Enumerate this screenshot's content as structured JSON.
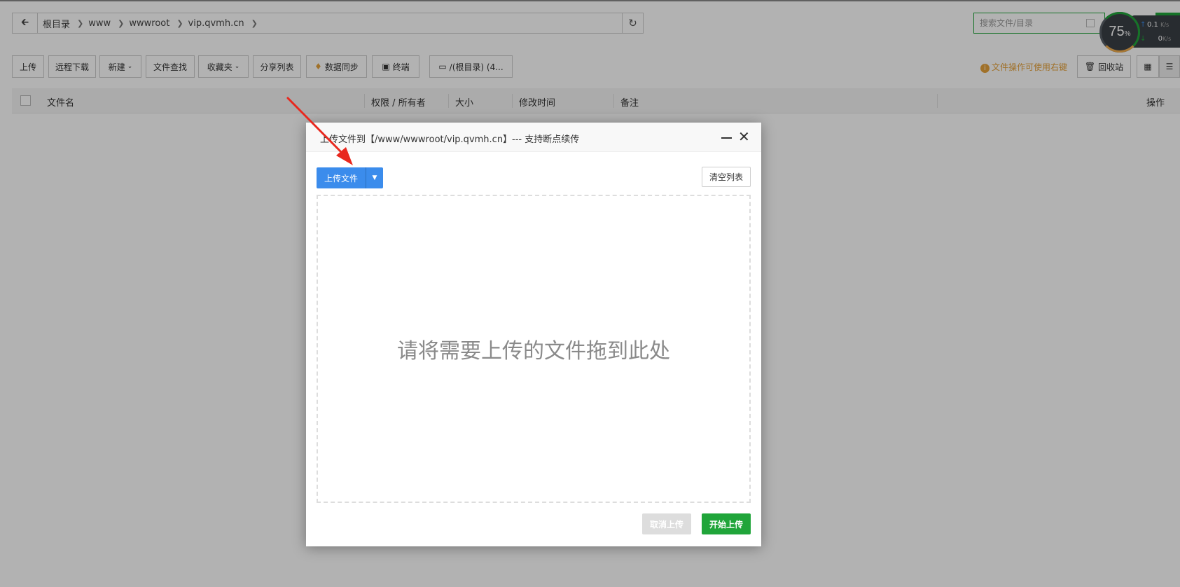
{
  "breadcrumb": {
    "back_icon": "arrow-left-icon",
    "items": [
      "根目录",
      "www",
      "wwwroot",
      "vip.qvmh.cn"
    ],
    "refresh_icon": "refresh-icon"
  },
  "search": {
    "placeholder": "搜索文件/目录"
  },
  "monitor": {
    "percent": "75",
    "percent_unit": "%",
    "up_value": "0.1",
    "down_value": "0",
    "unit": "K/s"
  },
  "toolbar": {
    "upload": "上传",
    "remote_download": "远程下载",
    "new": "新建",
    "file_search": "文件查找",
    "favorites": "收藏夹",
    "share_list": "分享列表",
    "data_sync": "数据同步",
    "terminal": "终端",
    "disk": "/(根目录) (4...",
    "tip": "文件操作可使用右键",
    "recycle": "回收站"
  },
  "table": {
    "headers": {
      "name": "文件名",
      "perm": "权限 / 所有者",
      "size": "大小",
      "mtime": "修改时间",
      "note": "备注",
      "ops": "操作"
    }
  },
  "modal": {
    "title": "上传文件到【/www/wwwroot/vip.qvmh.cn】--- 支持断点续传",
    "upload_btn": "上传文件",
    "clear_btn": "清空列表",
    "drop_text": "请将需要上传的文件拖到此处",
    "cancel_btn": "取消上传",
    "start_btn": "开始上传"
  },
  "colors": {
    "accent_green": "#20a53a",
    "upload_blue": "#3b8cec",
    "tip_orange": "#e6a23c",
    "annotation_red": "#e8281e"
  }
}
